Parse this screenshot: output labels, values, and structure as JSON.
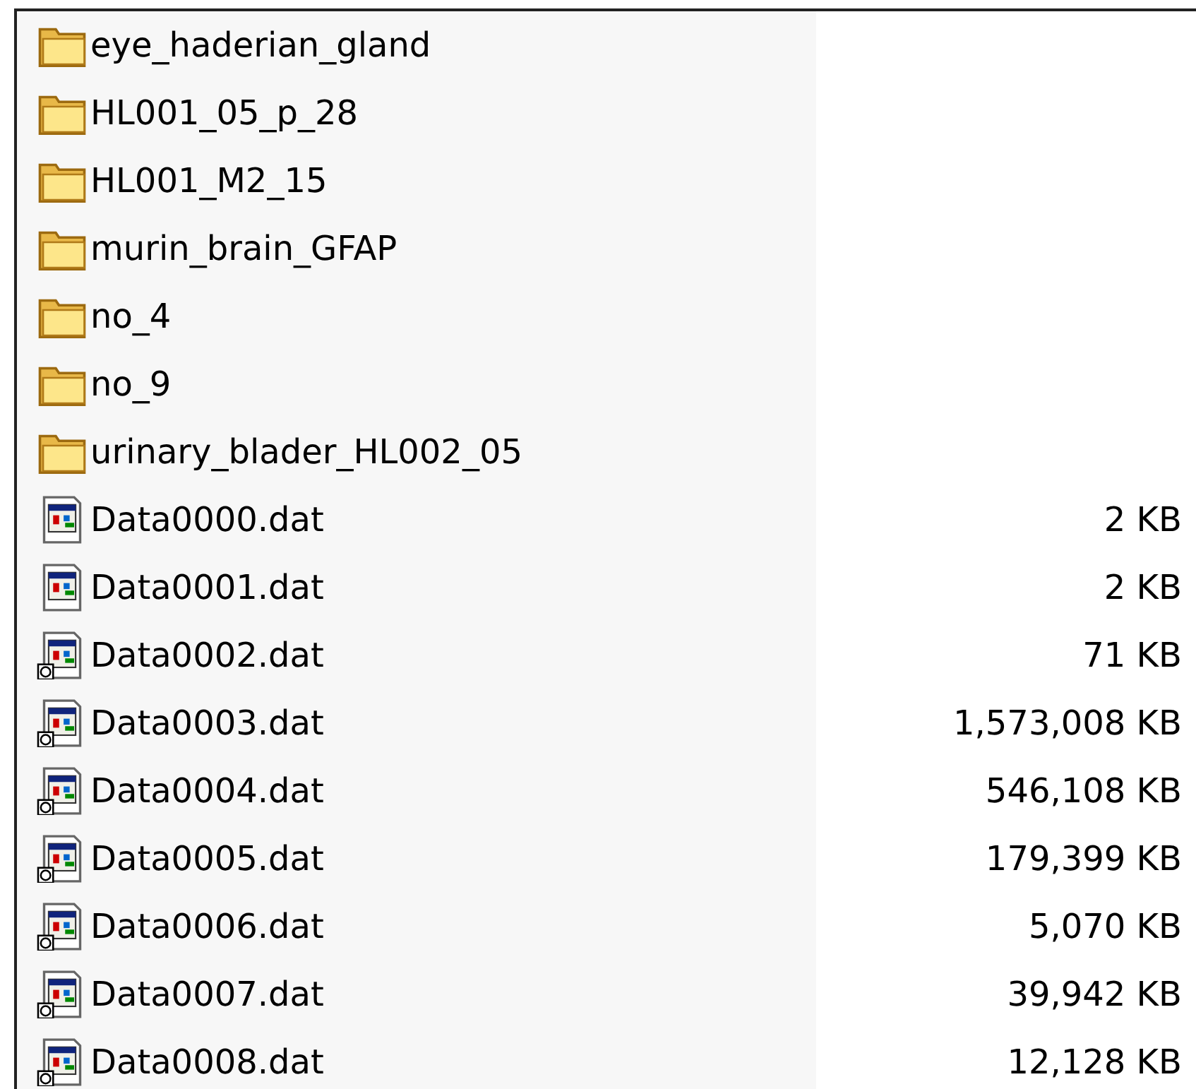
{
  "files": [
    {
      "kind": "folder",
      "name": "eye_haderian_gland"
    },
    {
      "kind": "folder",
      "name": "HL001_05_p_28"
    },
    {
      "kind": "folder",
      "name": "HL001_M2_15"
    },
    {
      "kind": "folder",
      "name": "murin_brain_GFAP"
    },
    {
      "kind": "folder",
      "name": "no_4"
    },
    {
      "kind": "folder",
      "name": "no_9"
    },
    {
      "kind": "folder",
      "name": "urinary_blader_HL002_05"
    },
    {
      "kind": "file",
      "name": "Data0000.dat",
      "size": "2 KB",
      "offline": false
    },
    {
      "kind": "file",
      "name": "Data0001.dat",
      "size": "2 KB",
      "offline": false
    },
    {
      "kind": "file",
      "name": "Data0002.dat",
      "size": "71 KB",
      "offline": true
    },
    {
      "kind": "file",
      "name": "Data0003.dat",
      "size": "1,573,008 KB",
      "offline": true
    },
    {
      "kind": "file",
      "name": "Data0004.dat",
      "size": "546,108 KB",
      "offline": true
    },
    {
      "kind": "file",
      "name": "Data0005.dat",
      "size": "179,399 KB",
      "offline": true
    },
    {
      "kind": "file",
      "name": "Data0006.dat",
      "size": "5,070 KB",
      "offline": true
    },
    {
      "kind": "file",
      "name": "Data0007.dat",
      "size": "39,942 KB",
      "offline": true
    },
    {
      "kind": "file",
      "name": "Data0008.dat",
      "size": "12,128 KB",
      "offline": true
    }
  ]
}
